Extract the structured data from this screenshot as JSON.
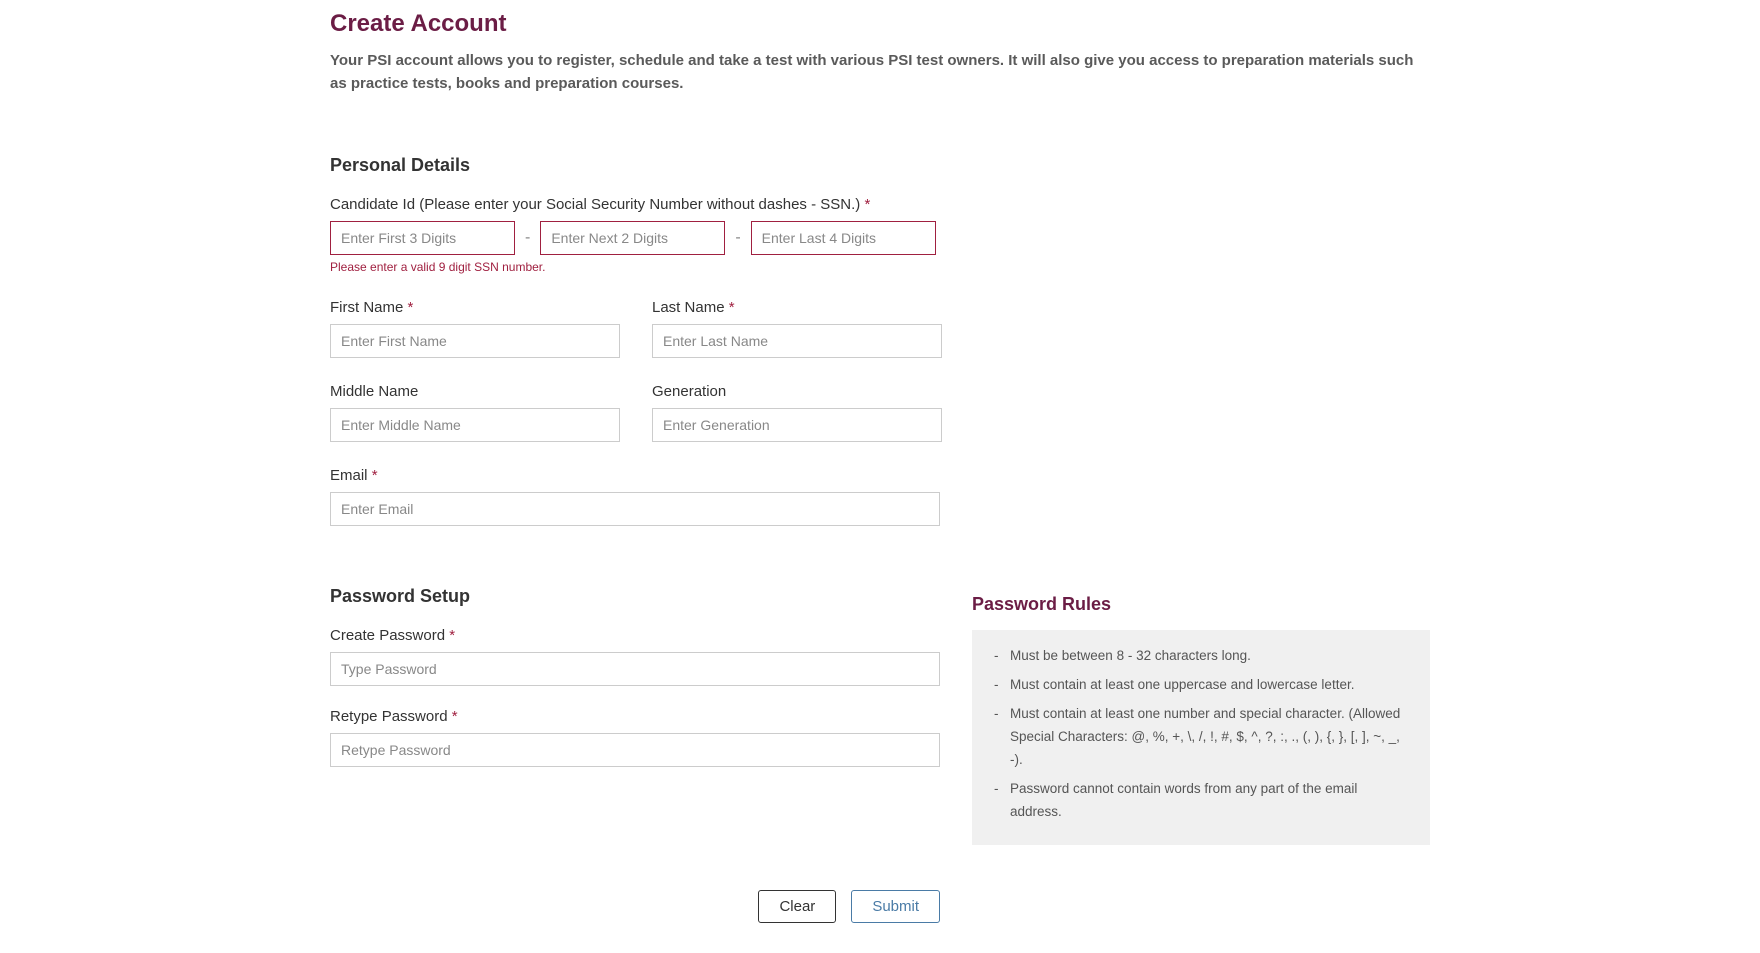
{
  "header": {
    "title": "Create Account",
    "description": "Your PSI account allows you to register, schedule and take a test with various PSI test owners. It will also give you access to preparation materials such as practice tests, books and preparation courses."
  },
  "personal": {
    "section_title": "Personal Details",
    "candidate_id_label": "Candidate Id (Please enter your Social Security Number without dashes - SSN.)",
    "ssn1_placeholder": "Enter First 3 Digits",
    "ssn2_placeholder": "Enter Next 2 Digits",
    "ssn3_placeholder": "Enter Last 4 Digits",
    "ssn_error": "Please enter a valid 9 digit SSN number.",
    "first_name_label": "First Name",
    "first_name_placeholder": "Enter First Name",
    "last_name_label": "Last Name",
    "last_name_placeholder": "Enter Last Name",
    "middle_name_label": "Middle Name",
    "middle_name_placeholder": "Enter Middle Name",
    "generation_label": "Generation",
    "generation_placeholder": "Enter Generation",
    "email_label": "Email",
    "email_placeholder": "Enter Email"
  },
  "password": {
    "section_title": "Password Setup",
    "create_label": "Create Password",
    "create_placeholder": "Type Password",
    "retype_label": "Retype Password",
    "retype_placeholder": "Retype Password"
  },
  "rules": {
    "title": "Password Rules",
    "items": [
      "Must be between 8 - 32 characters long.",
      "Must contain at least one uppercase and lowercase letter.",
      "Must contain at least one number and special character. (Allowed Special Characters: @, %, +, \\, /, !, #, $, ^, ?, :, ., (, ), {, }, [, ], ~, _, -).",
      "Password cannot contain words from any part of the email address."
    ]
  },
  "buttons": {
    "clear": "Clear",
    "submit": "Submit"
  },
  "required_mark": "*",
  "dash": "-"
}
